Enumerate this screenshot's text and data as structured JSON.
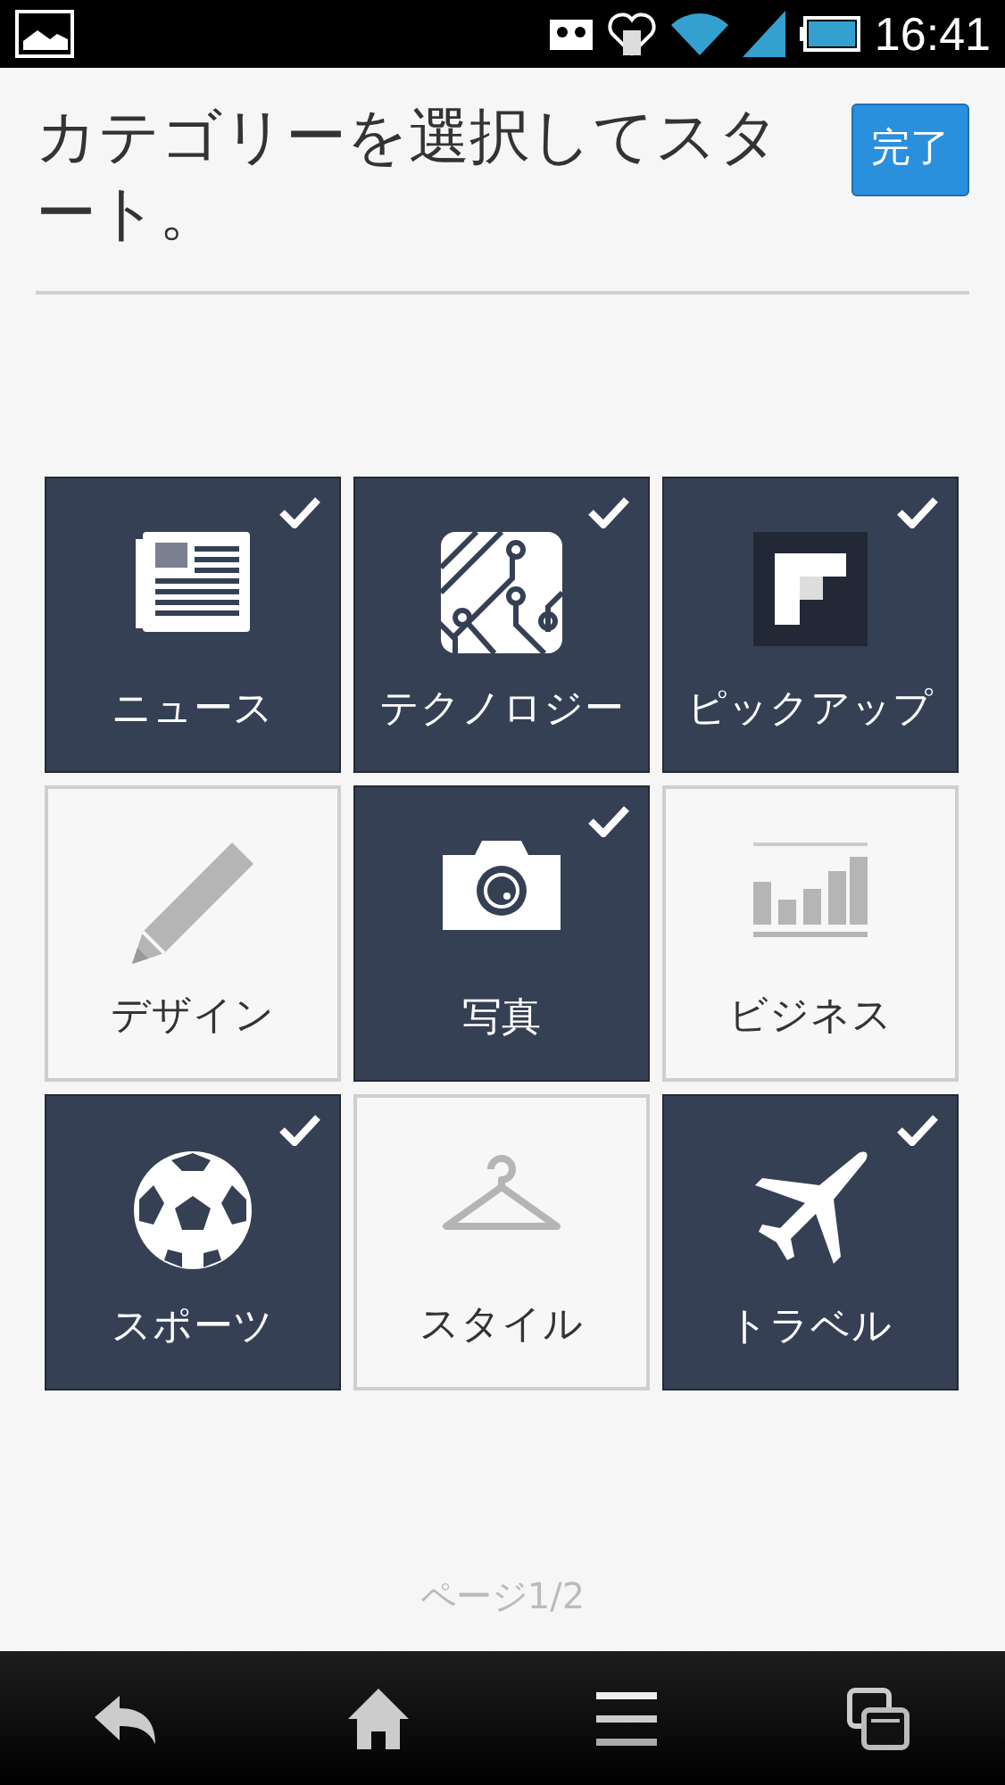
{
  "status_bar": {
    "time": "16:41"
  },
  "header": {
    "title": "カテゴリーを選択してスタート。",
    "done_button": "完了"
  },
  "categories": [
    {
      "label": "ニュース",
      "selected": true
    },
    {
      "label": "テクノロジー",
      "selected": true
    },
    {
      "label": "ピックアップ",
      "selected": true
    },
    {
      "label": "デザイン",
      "selected": false
    },
    {
      "label": "写真",
      "selected": true
    },
    {
      "label": "ビジネス",
      "selected": false
    },
    {
      "label": "スポーツ",
      "selected": true
    },
    {
      "label": "スタイル",
      "selected": false
    },
    {
      "label": "トラベル",
      "selected": true
    }
  ],
  "page_indicator": "ページ1/2"
}
